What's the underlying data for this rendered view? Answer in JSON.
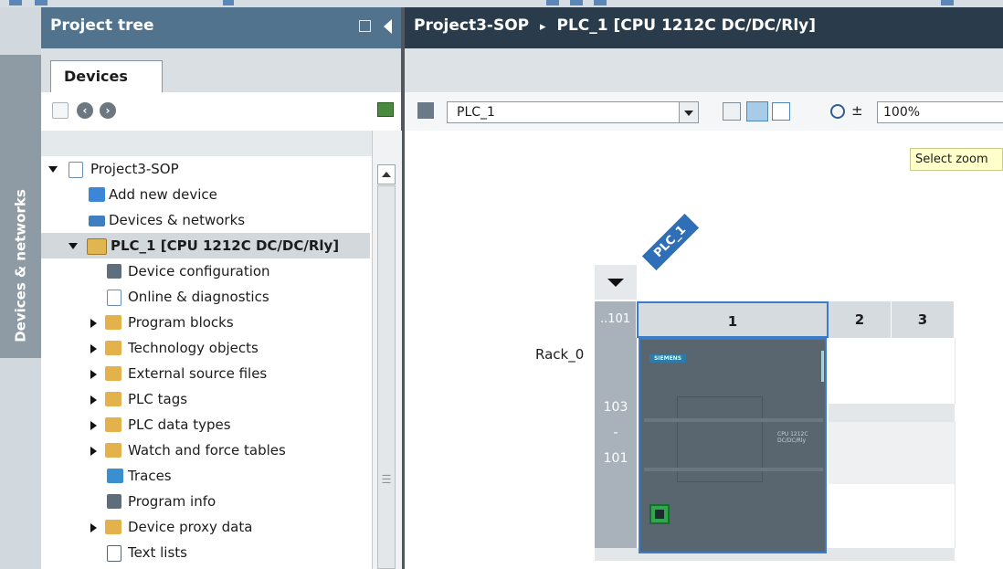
{
  "colors": {
    "tree_header": "#52738e",
    "main_header": "#2a3c4c",
    "accent_blue": "#3b7cc9",
    "selected_row": "#d3d8dc",
    "tooltip_bg": "#ffffcc"
  },
  "left_rail": {
    "label": "Devices & networks"
  },
  "project_tree": {
    "header": "Project tree",
    "tab": "Devices",
    "items": [
      {
        "label": "Project3-SOP",
        "expander": "down",
        "icon": "project-icon",
        "indent": 0
      },
      {
        "label": "Add new device",
        "expander": "none",
        "icon": "add-device-icon",
        "indent": 1
      },
      {
        "label": "Devices & networks",
        "expander": "none",
        "icon": "network-icon",
        "indent": 1
      },
      {
        "label": "PLC_1 [CPU 1212C DC/DC/Rly]",
        "expander": "down",
        "icon": "plc-icon",
        "indent": 1,
        "selected": true
      },
      {
        "label": "Device configuration",
        "expander": "none",
        "icon": "device-config-icon",
        "indent": 2
      },
      {
        "label": "Online & diagnostics",
        "expander": "none",
        "icon": "diagnostics-icon",
        "indent": 2
      },
      {
        "label": "Program blocks",
        "expander": "right",
        "icon": "folder-icon",
        "indent": 2
      },
      {
        "label": "Technology objects",
        "expander": "right",
        "icon": "folder-icon",
        "indent": 2
      },
      {
        "label": "External source files",
        "expander": "right",
        "icon": "folder-icon",
        "indent": 2
      },
      {
        "label": "PLC tags",
        "expander": "right",
        "icon": "folder-icon",
        "indent": 2
      },
      {
        "label": "PLC data types",
        "expander": "right",
        "icon": "folder-icon",
        "indent": 2
      },
      {
        "label": "Watch and force tables",
        "expander": "right",
        "icon": "folder-icon",
        "indent": 2
      },
      {
        "label": "Traces",
        "expander": "none",
        "icon": "traces-icon",
        "indent": 2
      },
      {
        "label": "Program info",
        "expander": "none",
        "icon": "program-info-icon",
        "indent": 2
      },
      {
        "label": "Device proxy data",
        "expander": "right",
        "icon": "folder-icon",
        "indent": 2
      },
      {
        "label": "Text lists",
        "expander": "none",
        "icon": "text-list-icon",
        "indent": 2
      }
    ]
  },
  "editor": {
    "breadcrumb_project": "Project3-SOP",
    "breadcrumb_sep": "▸",
    "breadcrumb_device": "PLC_1 [CPU 1212C DC/DC/Rly]",
    "device_select": "PLC_1",
    "zoom": "100%",
    "zoom_tooltip": "Select zoom",
    "zoom_sign": "±"
  },
  "rack": {
    "plc_tag": "PLC_1",
    "rack_name": "Rack_0",
    "slot_headers": [
      "..101",
      "1",
      "2",
      "3"
    ],
    "left_column": [
      "103",
      "-",
      "101"
    ],
    "cpu_brand": "SIEMENS",
    "cpu_model_line1": "CPU 1212C",
    "cpu_model_line2": "DC/DC/Rly"
  }
}
